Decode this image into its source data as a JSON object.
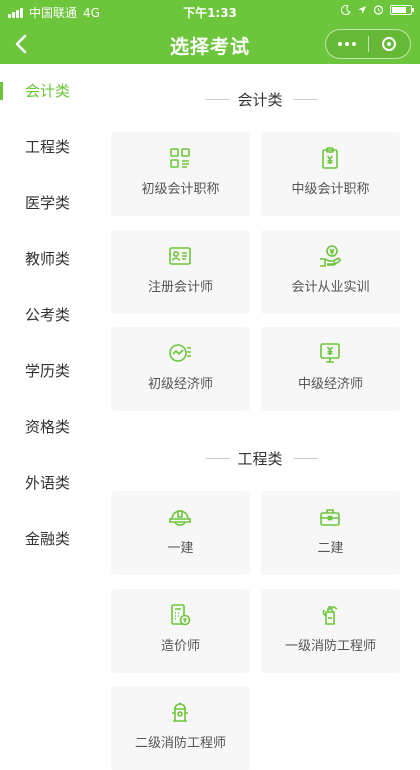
{
  "status_bar": {
    "carrier": "中国联通",
    "network": "4G",
    "time": "下午1:33"
  },
  "nav": {
    "title": "选择考试"
  },
  "colors": {
    "accent": "#6cc53a",
    "card_bg": "#f7f7f7",
    "text": "#333333"
  },
  "sidebar": {
    "items": [
      {
        "label": "会计类",
        "active": true
      },
      {
        "label": "工程类"
      },
      {
        "label": "医学类"
      },
      {
        "label": "教师类"
      },
      {
        "label": "公考类"
      },
      {
        "label": "学历类"
      },
      {
        "label": "资格类"
      },
      {
        "label": "外语类"
      },
      {
        "label": "金融类"
      }
    ]
  },
  "sections": [
    {
      "title": "会计类",
      "cards": [
        {
          "label": "初级会计职称",
          "icon": "grid-document-icon"
        },
        {
          "label": "中级会计职称",
          "icon": "clipboard-yen-icon"
        },
        {
          "label": "注册会计师",
          "icon": "id-card-icon"
        },
        {
          "label": "会计从业实训",
          "icon": "hand-coin-icon"
        },
        {
          "label": "初级经济师",
          "icon": "chart-gauge-icon"
        },
        {
          "label": "中级经济师",
          "icon": "monitor-yen-icon"
        }
      ]
    },
    {
      "title": "工程类",
      "cards": [
        {
          "label": "一建",
          "icon": "hard-hat-icon"
        },
        {
          "label": "二建",
          "icon": "toolbox-icon"
        },
        {
          "label": "造价师",
          "icon": "calculator-coin-icon"
        },
        {
          "label": "一级消防工程师",
          "icon": "fire-extinguisher-icon"
        },
        {
          "label": "二级消防工程师",
          "icon": "fire-hydrant-icon"
        }
      ]
    }
  ]
}
